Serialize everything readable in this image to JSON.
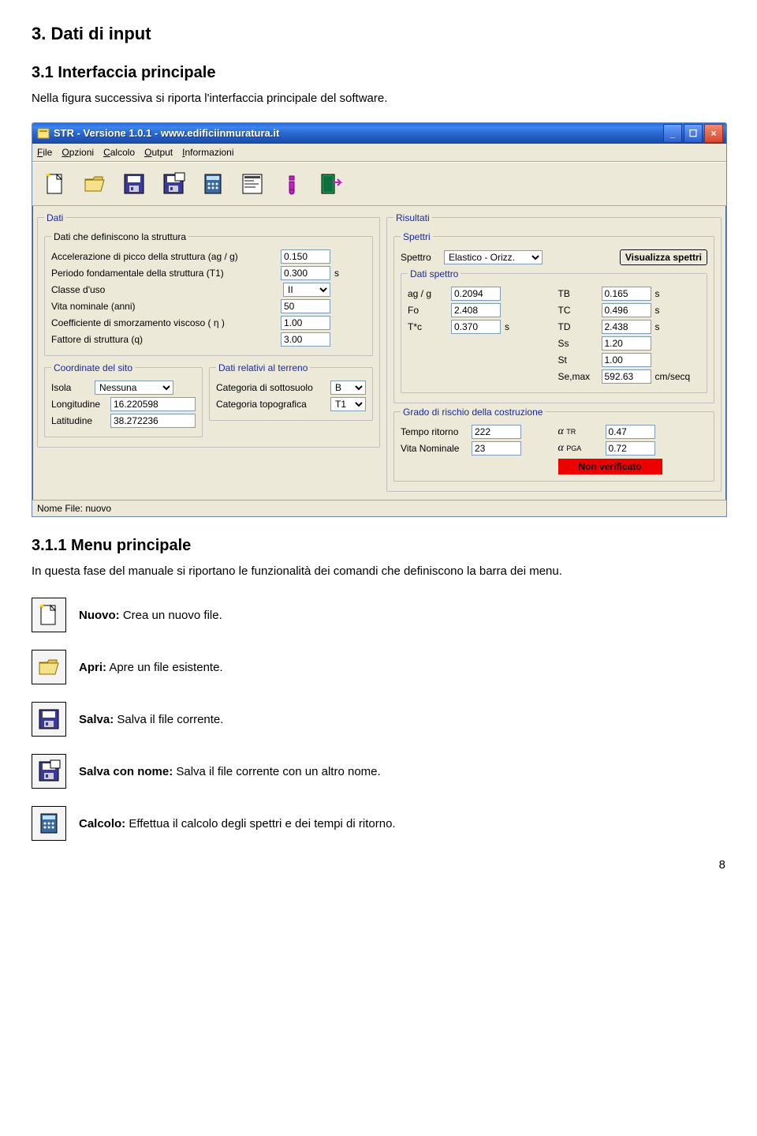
{
  "headings": {
    "h1": "3. Dati di input",
    "h2": "3.1 Interfaccia principale",
    "h3": "3.1.1 Menu principale"
  },
  "paras": {
    "p1": "Nella figura successiva si riporta l'interfaccia principale del software.",
    "p2": "In questa fase del manuale si riportano le funzionalità dei comandi che definiscono la barra dei menu."
  },
  "window_title": "STR  -  Versione 1.0.1    -  www.edificiinmuratura.it",
  "menu": [
    "File",
    "Opzioni",
    "Calcolo",
    "Output",
    "Informazioni"
  ],
  "dati_group": "Dati",
  "dati_sub1": "Dati che definiscono la struttura",
  "fields": {
    "ag_lbl": "Accelerazione di picco della struttura (ag / g)",
    "ag_val": "0.150",
    "t1_lbl": "Periodo fondamentale della struttura (T1)",
    "t1_val": "0.300",
    "t1_unit": "s",
    "classe_lbl": "Classe d'uso",
    "classe_val": "II",
    "vita_lbl": "Vita nominale (anni)",
    "vita_val": "50",
    "eta_lbl": "Coefficiente di smorzamento viscoso ( η )",
    "eta_val": "1.00",
    "q_lbl": "Fattore di struttura (q)",
    "q_val": "3.00"
  },
  "coord_group": "Coordinate del sito",
  "coord": {
    "isola_lbl": "Isola",
    "isola_val": "Nessuna",
    "lon_lbl": "Longitudine",
    "lon_val": "16.220598",
    "lat_lbl": "Latitudine",
    "lat_val": "38.272236"
  },
  "terreno_group": "Dati relativi al terreno",
  "terreno": {
    "sott_lbl": "Categoria di sottosuolo",
    "sott_val": "B",
    "topo_lbl": "Categoria topografica",
    "topo_val": "T1"
  },
  "ris_group": "Risultati",
  "spettri_group": "Spettri",
  "spettro_lbl": "Spettro",
  "spettro_val": "Elastico - Orizz.",
  "vis_btn": "Visualizza spettri",
  "datispettro_group": "Dati spettro",
  "ds": {
    "agg_lbl": "ag / g",
    "agg_val": "0.2094",
    "fo_lbl": "Fo",
    "fo_val": "2.408",
    "tc_lbl": "T*c",
    "tc_val": "0.370",
    "tc_unit": "s",
    "tb_lbl": "TB",
    "tb_val": "0.165",
    "tb_unit": "s",
    "tcc_lbl": "TC",
    "tcc_val": "0.496",
    "tcc_unit": "s",
    "td_lbl": "TD",
    "td_val": "2.438",
    "td_unit": "s",
    "ss_lbl": "Ss",
    "ss_val": "1.20",
    "st_lbl": "St",
    "st_val": "1.00",
    "se_lbl": "Se,max",
    "se_val": "592.63",
    "se_unit": "cm/secq"
  },
  "grade_group": "Grado di rischio della costruzione",
  "grade": {
    "tr_lbl": "Tempo ritorno",
    "tr_val": "222",
    "vn_lbl": "Vita Nominale",
    "vn_val": "23",
    "atr_lbl": "TR",
    "atr_val": "0.47",
    "apga_lbl": "PGA",
    "apga_val": "0.72",
    "nonver": "Non verificato"
  },
  "statusbar": "Nome File: nuovo",
  "list": {
    "nuovo_b": "Nuovo:",
    "nuovo_t": " Crea un nuovo file.",
    "apri_b": "Apri:",
    "apri_t": " Apre un file esistente.",
    "salva_b": "Salva:",
    "salva_t": " Salva il file corrente.",
    "salvan_b": "Salva con nome:",
    "salvan_t": " Salva il file corrente con un altro nome.",
    "calc_b": "Calcolo:",
    "calc_t": " Effettua il calcolo degli spettri e dei tempi di ritorno."
  },
  "page_number": "8"
}
